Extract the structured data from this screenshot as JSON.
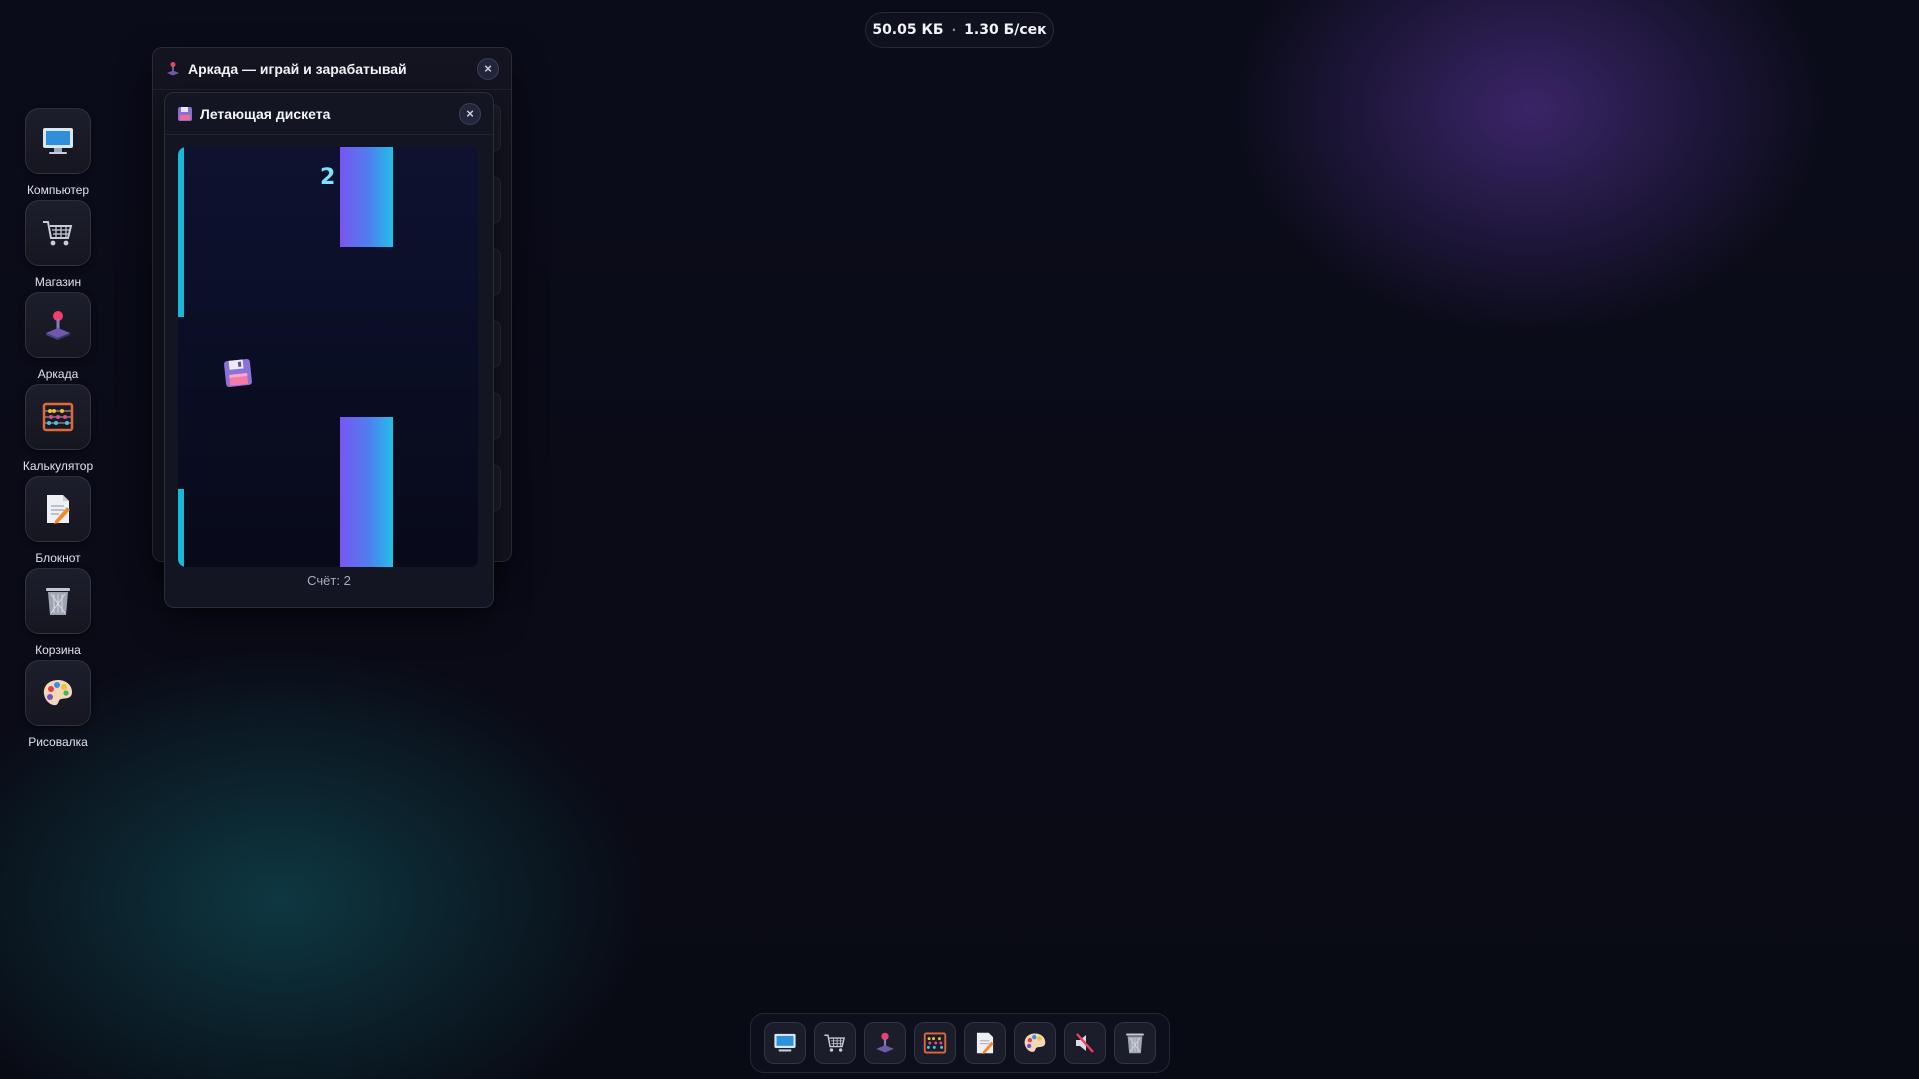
{
  "status": {
    "storage": "50.05 КБ",
    "separator": "·",
    "speed": "1.30 Б/сек"
  },
  "desktop_icons": [
    {
      "label": "Компьютер",
      "icon": "computer-icon"
    },
    {
      "label": "Магазин",
      "icon": "cart-icon"
    },
    {
      "label": "Аркада",
      "icon": "joystick-icon"
    },
    {
      "label": "Калькулятор",
      "icon": "abacus-icon"
    },
    {
      "label": "Блокнот",
      "icon": "notepad-icon"
    },
    {
      "label": "Корзина",
      "icon": "trash-icon"
    },
    {
      "label": "Рисовалка",
      "icon": "palette-icon"
    }
  ],
  "arcade_window": {
    "title": "Аркада — играй и зарабатывай",
    "close": "×"
  },
  "game_window": {
    "title": "Летающая дискета",
    "close": "×",
    "score_display": "2",
    "score_label": "Счёт: 2"
  },
  "taskbar": [
    {
      "icon": "computer-icon"
    },
    {
      "icon": "cart-icon"
    },
    {
      "icon": "joystick-icon"
    },
    {
      "icon": "abacus-icon"
    },
    {
      "icon": "notepad-icon"
    },
    {
      "icon": "palette-icon"
    },
    {
      "icon": "speaker-muted-icon"
    },
    {
      "icon": "trash-icon"
    }
  ]
}
